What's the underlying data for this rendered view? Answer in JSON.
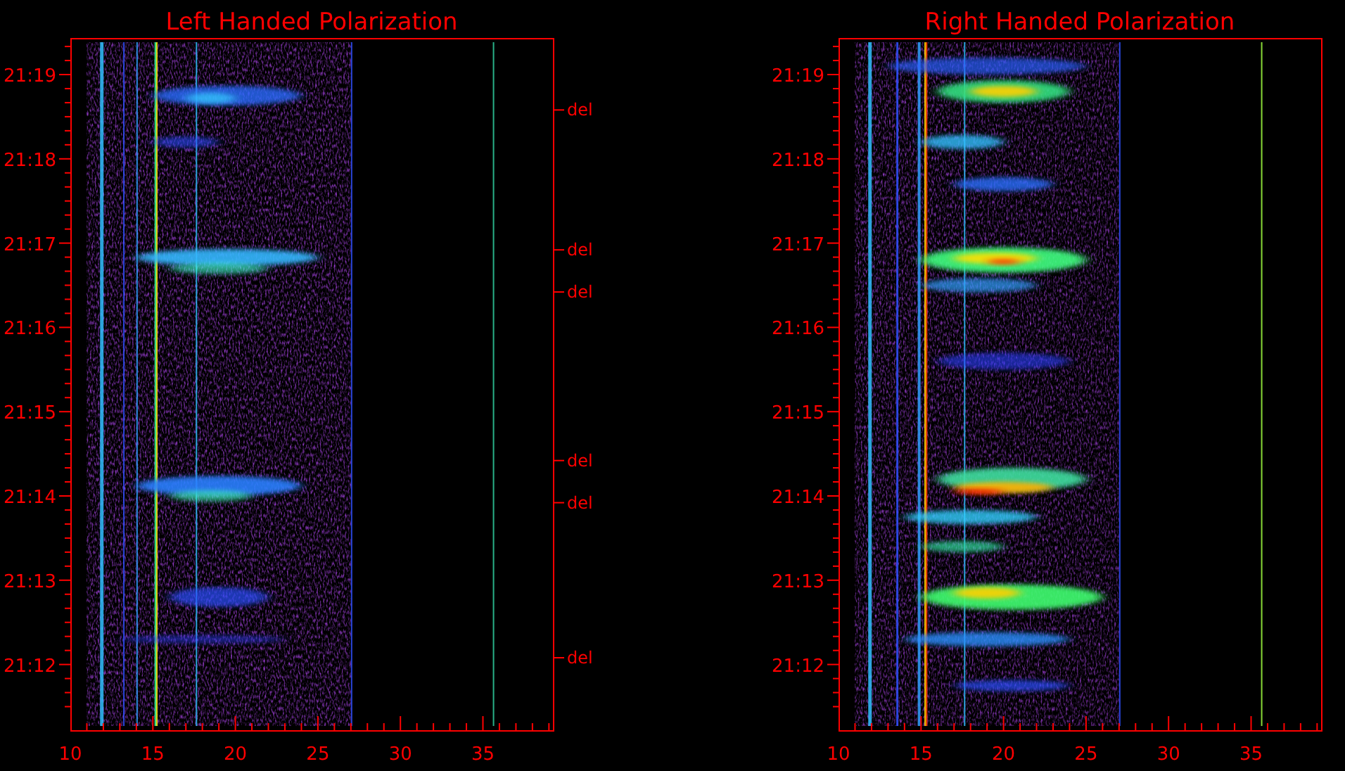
{
  "panels": [
    {
      "title": "Left Handed Polarization",
      "y_labels": [
        "21:19",
        "21:18",
        "21:17",
        "21:16",
        "21:15",
        "21:14",
        "21:13",
        "21:12"
      ],
      "x_labels": [
        "10",
        "15",
        "20",
        "25",
        "30",
        "35"
      ],
      "markers": [
        "del",
        "del",
        "del",
        "del",
        "del",
        "del"
      ]
    },
    {
      "title": "Right Handed Polarization",
      "y_labels": [
        "21:19",
        "21:18",
        "21:17",
        "21:16",
        "21:15",
        "21:14",
        "21:13",
        "21:12"
      ],
      "x_labels": [
        "10",
        "15",
        "20",
        "25",
        "30",
        "35"
      ]
    }
  ]
}
